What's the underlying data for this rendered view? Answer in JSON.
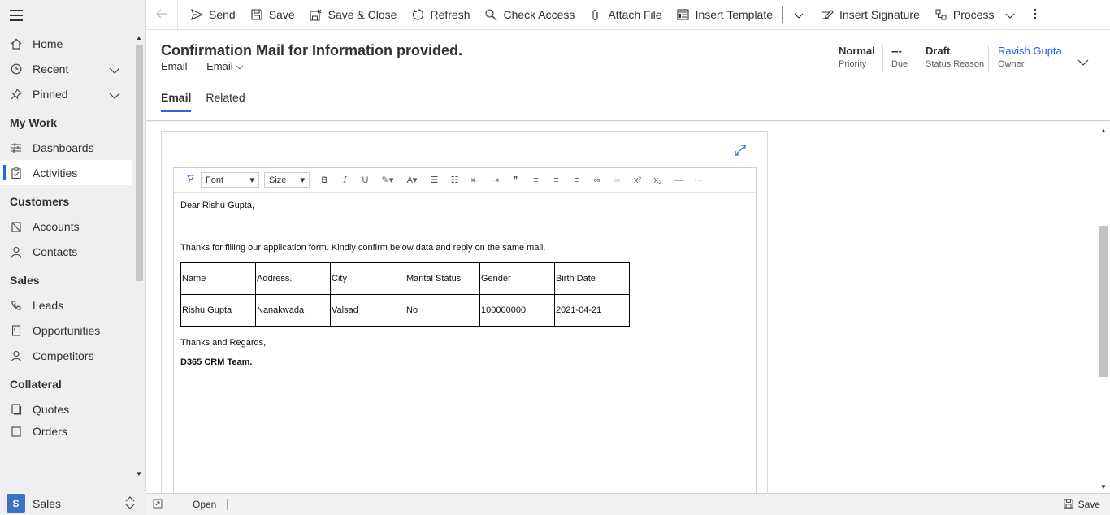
{
  "sidebar": {
    "top_items": [
      {
        "label": "Home"
      },
      {
        "label": "Recent"
      },
      {
        "label": "Pinned"
      }
    ],
    "sections": [
      {
        "title": "My Work",
        "items": [
          "Dashboards",
          "Activities"
        ]
      },
      {
        "title": "Customers",
        "items": [
          "Accounts",
          "Contacts"
        ]
      },
      {
        "title": "Sales",
        "items": [
          "Leads",
          "Opportunities",
          "Competitors"
        ]
      },
      {
        "title": "Collateral",
        "items": [
          "Quotes",
          "Orders"
        ]
      }
    ],
    "active_item": "Activities",
    "area": {
      "badge": "S",
      "label": "Sales"
    }
  },
  "commandbar": {
    "send": "Send",
    "save": "Save",
    "save_close": "Save & Close",
    "refresh": "Refresh",
    "check_access": "Check Access",
    "attach_file": "Attach File",
    "insert_template": "Insert Template",
    "insert_signature": "Insert Signature",
    "process": "Process"
  },
  "header": {
    "title": "Confirmation Mail for Information provided.",
    "entity": "Email",
    "form": "Email",
    "priority": {
      "value": "Normal",
      "label": "Priority"
    },
    "due": {
      "value": "---",
      "label": "Due"
    },
    "status_reason": {
      "value": "Draft",
      "label": "Status Reason"
    },
    "owner": {
      "value": "Ravish Gupta",
      "label": "Owner"
    },
    "tabs": [
      "Email",
      "Related"
    ]
  },
  "editor": {
    "font_placeholder": "Font",
    "size_placeholder": "Size",
    "greeting": "Dear Rishu Gupta,",
    "intro": "Thanks for filling our application form. Kindly confirm below data and reply on the same mail.",
    "table": {
      "headers": [
        "Name",
        "Address.",
        "City",
        "Marital Status",
        "Gender",
        "Birth Date"
      ],
      "row": [
        "Rishu Gupta",
        "Nanakwada",
        "Valsad",
        "No",
        "100000000",
        "2021-04-21"
      ]
    },
    "closing": "Thanks and Regards,",
    "signature": "D365 CRM Team."
  },
  "footer": {
    "status": "Open",
    "save": "Save"
  },
  "colors": {
    "accent": "#2266e3",
    "sidebar_bg": "#efefef",
    "area_badge": "#3b72c5"
  }
}
